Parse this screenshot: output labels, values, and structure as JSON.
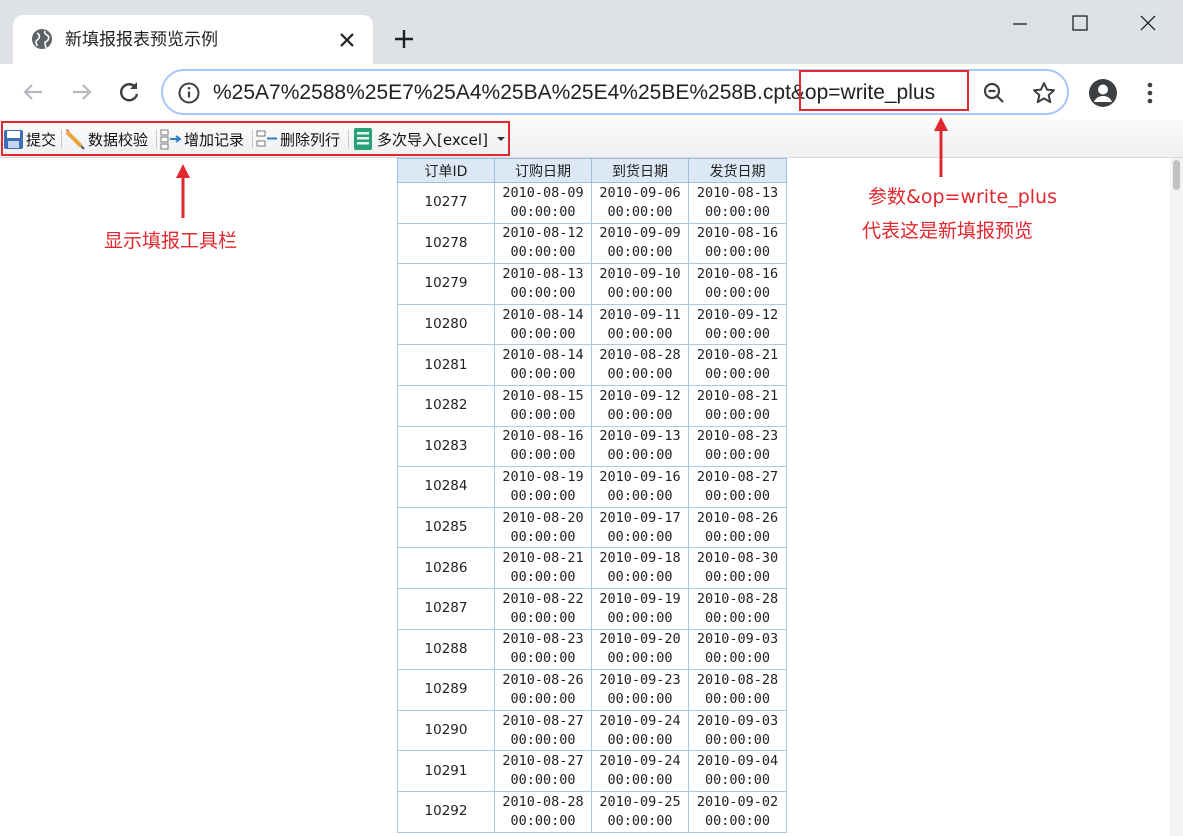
{
  "browser": {
    "tab_title": "新填报报表预览示例",
    "url": "%25A7%2588%25E7%25A4%25BA%25E4%25BE%258B.cpt&op=write_plus"
  },
  "report_toolbar": {
    "items": [
      {
        "label": "提交",
        "icon": "save-icon"
      },
      {
        "label": "数据校验",
        "icon": "pencil-icon"
      },
      {
        "label": "增加记录",
        "icon": "insert-row-icon"
      },
      {
        "label": "删除列行",
        "icon": "delete-row-icon"
      },
      {
        "label": "多次导入[excel]",
        "icon": "excel-icon"
      }
    ]
  },
  "report": {
    "headers": [
      "订单ID",
      "订购日期",
      "到货日期",
      "发货日期"
    ],
    "rows": [
      [
        "10277",
        "2010-08-09 00:00:00",
        "2010-09-06 00:00:00",
        "2010-08-13 00:00:00"
      ],
      [
        "10278",
        "2010-08-12 00:00:00",
        "2010-09-09 00:00:00",
        "2010-08-16 00:00:00"
      ],
      [
        "10279",
        "2010-08-13 00:00:00",
        "2010-09-10 00:00:00",
        "2010-08-16 00:00:00"
      ],
      [
        "10280",
        "2010-08-14 00:00:00",
        "2010-09-11 00:00:00",
        "2010-09-12 00:00:00"
      ],
      [
        "10281",
        "2010-08-14 00:00:00",
        "2010-08-28 00:00:00",
        "2010-08-21 00:00:00"
      ],
      [
        "10282",
        "2010-08-15 00:00:00",
        "2010-09-12 00:00:00",
        "2010-08-21 00:00:00"
      ],
      [
        "10283",
        "2010-08-16 00:00:00",
        "2010-09-13 00:00:00",
        "2010-08-23 00:00:00"
      ],
      [
        "10284",
        "2010-08-19 00:00:00",
        "2010-09-16 00:00:00",
        "2010-08-27 00:00:00"
      ],
      [
        "10285",
        "2010-08-20 00:00:00",
        "2010-09-17 00:00:00",
        "2010-08-26 00:00:00"
      ],
      [
        "10286",
        "2010-08-21 00:00:00",
        "2010-09-18 00:00:00",
        "2010-08-30 00:00:00"
      ],
      [
        "10287",
        "2010-08-22 00:00:00",
        "2010-09-19 00:00:00",
        "2010-08-28 00:00:00"
      ],
      [
        "10288",
        "2010-08-23 00:00:00",
        "2010-09-20 00:00:00",
        "2010-09-03 00:00:00"
      ],
      [
        "10289",
        "2010-08-26 00:00:00",
        "2010-09-23 00:00:00",
        "2010-08-28 00:00:00"
      ],
      [
        "10290",
        "2010-08-27 00:00:00",
        "2010-09-24 00:00:00",
        "2010-09-03 00:00:00"
      ],
      [
        "10291",
        "2010-08-27 00:00:00",
        "2010-09-24 00:00:00",
        "2010-09-04 00:00:00"
      ],
      [
        "10292",
        "2010-08-28 00:00:00",
        "2010-09-25 00:00:00",
        "2010-09-02 00:00:00"
      ]
    ]
  },
  "annotations": {
    "toolbar_note": "显示填报工具栏",
    "param_note_line1": "参数&op=write_plus",
    "param_note_line2": "代表这是新填报预览"
  },
  "colors": {
    "annotation_red": "#e0282e",
    "header_bg": "#dce9f5",
    "grid_border": "#a9cbe3"
  }
}
